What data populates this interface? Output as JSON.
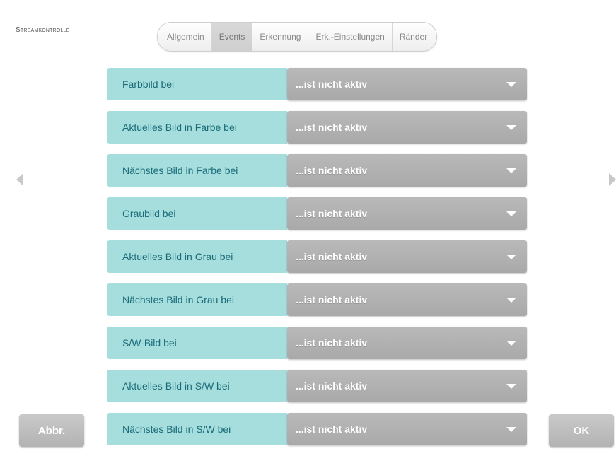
{
  "header": {
    "title": "Streamkontrolle"
  },
  "tabs": [
    {
      "label": "Allgemein",
      "active": false
    },
    {
      "label": "Events",
      "active": true
    },
    {
      "label": "Erkennung",
      "active": false
    },
    {
      "label": "Erk.-Einstellungen",
      "active": false
    },
    {
      "label": "Ränder",
      "active": false
    }
  ],
  "rows": [
    {
      "label": "Farbbild bei",
      "value": "...ist nicht aktiv"
    },
    {
      "label": "Aktuelles Bild in Farbe bei",
      "value": "...ist nicht aktiv"
    },
    {
      "label": "Nächstes Bild in Farbe bei",
      "value": "...ist nicht aktiv"
    },
    {
      "label": "Graubild bei",
      "value": "...ist nicht aktiv"
    },
    {
      "label": "Aktuelles Bild in Grau bei",
      "value": "...ist nicht aktiv"
    },
    {
      "label": "Nächstes Bild in Grau bei",
      "value": "...ist nicht aktiv"
    },
    {
      "label": "S/W-Bild bei",
      "value": "...ist nicht aktiv"
    },
    {
      "label": "Aktuelles Bild in S/W bei",
      "value": "...ist nicht aktiv"
    },
    {
      "label": "Nächstes Bild in S/W bei",
      "value": "...ist nicht aktiv"
    }
  ],
  "buttons": {
    "cancel": "Abbr.",
    "ok": "OK"
  },
  "icons": {
    "prev": "chevron-left-icon",
    "next": "chevron-right-icon",
    "dropdown": "caret-down-icon"
  },
  "colors": {
    "label_bg": "#a6dede",
    "label_text": "#1a6b78",
    "select_bg": "#b0b0b0"
  }
}
